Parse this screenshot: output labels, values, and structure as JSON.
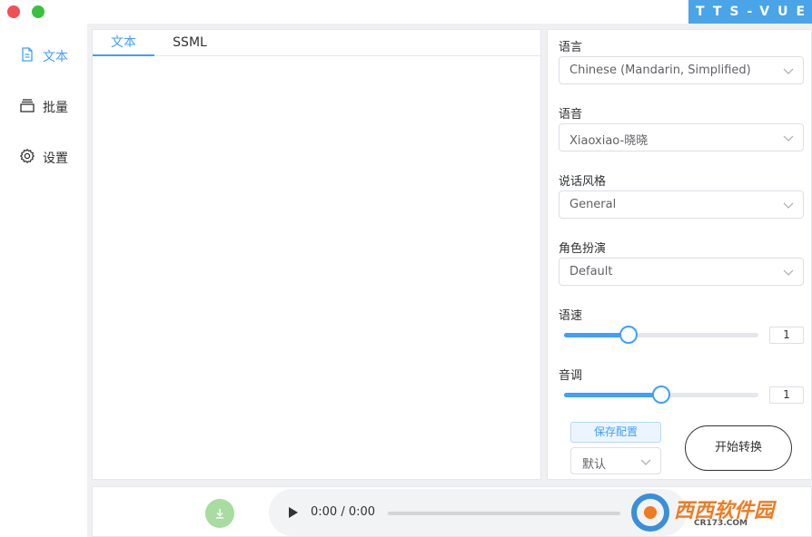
{
  "app": {
    "brand": "TTS-VUE"
  },
  "sidebar": {
    "items": [
      {
        "label": "文本",
        "icon": "document-icon",
        "active": true
      },
      {
        "label": "批量",
        "icon": "batch-icon",
        "active": false
      },
      {
        "label": "设置",
        "icon": "gear-icon",
        "active": false
      }
    ]
  },
  "editor": {
    "tabs": [
      {
        "label": "文本"
      },
      {
        "label": "SSML"
      }
    ],
    "text": ""
  },
  "settings": {
    "language": {
      "label": "语言",
      "value": "Chinese (Mandarin, Simplified)"
    },
    "voice": {
      "label": "语音",
      "value": "Xiaoxiao-晓晓"
    },
    "style": {
      "label": "说话风格",
      "value": "General"
    },
    "role": {
      "label": "角色扮演",
      "value": "Default"
    },
    "rate": {
      "label": "语速",
      "value": "1",
      "fraction": 0.33
    },
    "pitch": {
      "label": "音调",
      "value": "1",
      "fraction": 0.5
    },
    "save_label": "保存配置",
    "profile_value": "默认",
    "start_label": "开始转换"
  },
  "player": {
    "time": "0:00 / 0:00"
  },
  "watermark": {
    "text": "西西软件园",
    "sub": "CR173.COM"
  },
  "colors": {
    "accent": "#409eff",
    "brand_bg": "#4aa4e8",
    "download_bg": "#a8dca0"
  }
}
